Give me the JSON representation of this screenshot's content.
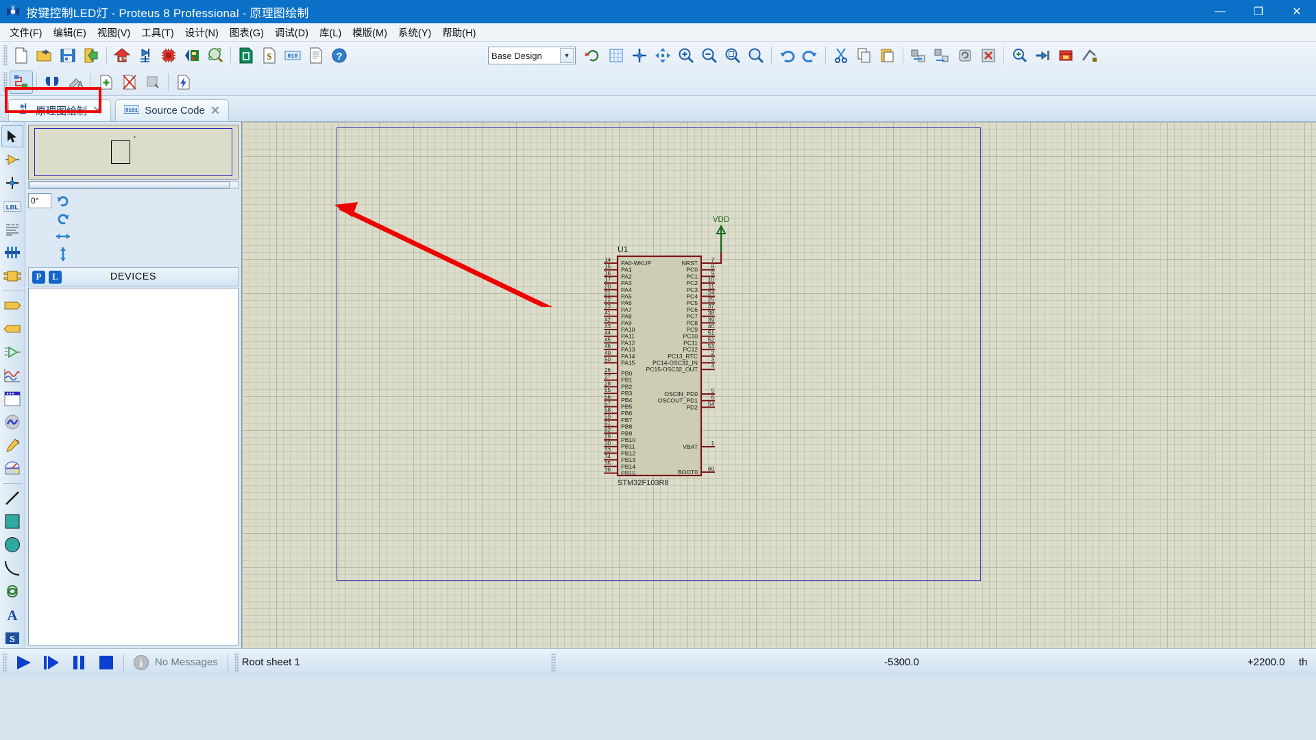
{
  "window": {
    "title": "按键控制LED灯 - Proteus 8 Professional - 原理图绘制",
    "app_icon": "proteus-icon",
    "minimize": "—",
    "maximize": "❐",
    "close": "✕"
  },
  "menubar": {
    "items": [
      {
        "label": "文件(F)",
        "name": "menu-file"
      },
      {
        "label": "编辑(E)",
        "name": "menu-edit"
      },
      {
        "label": "视图(V)",
        "name": "menu-view"
      },
      {
        "label": "工具(T)",
        "name": "menu-tools"
      },
      {
        "label": "设计(N)",
        "name": "menu-design"
      },
      {
        "label": "图表(G)",
        "name": "menu-graph"
      },
      {
        "label": "调试(D)",
        "name": "menu-debug"
      },
      {
        "label": "库(L)",
        "name": "menu-library"
      },
      {
        "label": "模版(M)",
        "name": "menu-template"
      },
      {
        "label": "系统(Y)",
        "name": "menu-system"
      },
      {
        "label": "帮助(H)",
        "name": "menu-help"
      }
    ]
  },
  "toolbar": {
    "design_selector": {
      "value": "Base Design",
      "caret": "▼"
    },
    "row1_icons": [
      "new-project-icon",
      "open-project-icon",
      "save-project-icon",
      "import-export-icon",
      "home-page-icon",
      "schematic-capture-icon",
      "pcb-layout-icon",
      "3d-visualizer-icon",
      "design-explorer-icon",
      "bill-of-materials-icon",
      "billing-icon",
      "source-code-icon",
      "project-notes-icon",
      "help-icon"
    ],
    "row1b_icons": [
      "refresh-icon",
      "grid-toggle-icon",
      "origin-icon",
      "pan-icon",
      "zoom-in-icon",
      "zoom-out-icon",
      "zoom-area-icon",
      "zoom-all-icon",
      "undo-icon",
      "redo-icon",
      "cut-icon",
      "copy-icon",
      "paste-icon",
      "block-copy-icon",
      "block-move-icon",
      "block-rotate-icon",
      "block-delete-icon",
      "pick-device-icon",
      "make-device-icon",
      "packaging-tool-icon",
      "decompose-icon"
    ],
    "row2_icons": [
      "wire-auto-router-icon",
      "search-tag-icon",
      "property-assignment-icon",
      "new-sheet-icon",
      "remove-sheet-icon",
      "exit-sheet-icon",
      "design-explorer2-icon"
    ]
  },
  "tabs": [
    {
      "label": "原理图绘制",
      "icon": "schematic-tab-icon",
      "close": "✕",
      "selected": true,
      "name": "tab-schematic"
    },
    {
      "label": "Source Code",
      "icon": "source-code-tab-icon",
      "close": "✕",
      "selected": false,
      "name": "tab-source-code"
    }
  ],
  "toolbox": {
    "items": [
      {
        "name": "selection-mode-icon",
        "selected": true
      },
      {
        "name": "component-mode-icon",
        "selected": false
      },
      {
        "name": "junction-dot-icon",
        "selected": false
      },
      {
        "name": "wire-label-icon",
        "selected": false,
        "text": "LBL"
      },
      {
        "name": "text-script-icon",
        "selected": false
      },
      {
        "name": "bus-mode-icon",
        "selected": false
      },
      {
        "name": "subcircuit-icon",
        "selected": false
      },
      {
        "name": "terminals-mode-icon",
        "selected": false
      },
      {
        "name": "device-pins-icon",
        "selected": false
      },
      {
        "name": "graph-mode-icon",
        "selected": false
      },
      {
        "name": "tape-recorder-icon",
        "selected": false
      },
      {
        "name": "generator-mode-icon",
        "selected": false
      },
      {
        "name": "voltage-probe-icon",
        "selected": false
      },
      {
        "name": "virtual-instruments-icon",
        "selected": false
      },
      {
        "name": "line-tool-icon",
        "selected": false
      },
      {
        "name": "box-tool-icon",
        "selected": false
      },
      {
        "name": "circle-tool-icon",
        "selected": false
      },
      {
        "name": "arc-tool-icon",
        "selected": false
      },
      {
        "name": "path-tool-icon",
        "selected": false
      },
      {
        "name": "text-tool-icon",
        "selected": false,
        "text": "A"
      },
      {
        "name": "symbol-tool-icon",
        "selected": false,
        "text": "S"
      }
    ]
  },
  "left_panel": {
    "rotation": {
      "angle_value": "0°",
      "rotate_cw_icon": "rotate-clockwise-icon",
      "rotate_ccw_icon": "rotate-counterclockwise-icon",
      "mirror_x_icon": "mirror-horizontal-icon",
      "mirror_y_icon": "mirror-vertical-icon"
    },
    "devices": {
      "p_button": "P",
      "l_button": "L",
      "title": "DEVICES",
      "items": []
    }
  },
  "schematic": {
    "component": {
      "reference": "U1",
      "part_value": "STM32F103R8",
      "left_pins": [
        {
          "num": "14",
          "label": "PA0-WKUP"
        },
        {
          "num": "15",
          "label": "PA1"
        },
        {
          "num": "16",
          "label": "PA2"
        },
        {
          "num": "17",
          "label": "PA3"
        },
        {
          "num": "20",
          "label": "PA4"
        },
        {
          "num": "21",
          "label": "PA5"
        },
        {
          "num": "22",
          "label": "PA6"
        },
        {
          "num": "23",
          "label": "PA7"
        },
        {
          "num": "41",
          "label": "PA8"
        },
        {
          "num": "42",
          "label": "PA9"
        },
        {
          "num": "43",
          "label": "PA10"
        },
        {
          "num": "44",
          "label": "PA11"
        },
        {
          "num": "45",
          "label": "PA12"
        },
        {
          "num": "46",
          "label": "PA13"
        },
        {
          "num": "49",
          "label": "PA14"
        },
        {
          "num": "50",
          "label": "PA15"
        }
      ],
      "left_pins_b": [
        {
          "num": "26",
          "label": "PB0"
        },
        {
          "num": "27",
          "label": "PB1"
        },
        {
          "num": "28",
          "label": "PB2"
        },
        {
          "num": "55",
          "label": "PB3"
        },
        {
          "num": "56",
          "label": "PB4"
        },
        {
          "num": "57",
          "label": "PB5"
        },
        {
          "num": "58",
          "label": "PB6"
        },
        {
          "num": "59",
          "label": "PB7"
        },
        {
          "num": "61",
          "label": "PB8"
        },
        {
          "num": "62",
          "label": "PB9"
        },
        {
          "num": "29",
          "label": "PB10"
        },
        {
          "num": "30",
          "label": "PB11"
        },
        {
          "num": "33",
          "label": "PB12"
        },
        {
          "num": "34",
          "label": "PB13"
        },
        {
          "num": "35",
          "label": "PB14"
        },
        {
          "num": "36",
          "label": "PB15"
        }
      ],
      "right_pins": [
        {
          "num": "7",
          "label": "NRST"
        },
        {
          "num": "8",
          "label": "PC0"
        },
        {
          "num": "9",
          "label": "PC1"
        },
        {
          "num": "10",
          "label": "PC2"
        },
        {
          "num": "11",
          "label": "PC3"
        },
        {
          "num": "24",
          "label": "PC4"
        },
        {
          "num": "25",
          "label": "PC5"
        },
        {
          "num": "37",
          "label": "PC6"
        },
        {
          "num": "38",
          "label": "PC7"
        },
        {
          "num": "39",
          "label": "PC8"
        },
        {
          "num": "40",
          "label": "PC9"
        },
        {
          "num": "51",
          "label": "PC10"
        },
        {
          "num": "52",
          "label": "PC11"
        },
        {
          "num": "53",
          "label": "PC12"
        },
        {
          "num": "2",
          "label": "PC13_RTC"
        },
        {
          "num": "3",
          "label": "PC14-OSC32_IN"
        },
        {
          "num": "4",
          "label": "PC15-OSC32_OUT"
        }
      ],
      "right_pins_d": [
        {
          "num": "5",
          "label": "OSCIN_PD0"
        },
        {
          "num": "6",
          "label": "OSCOUT_PD1"
        },
        {
          "num": "54",
          "label": "PD2"
        }
      ],
      "right_pins_misc": [
        {
          "num": "1",
          "label": "VBAT"
        },
        {
          "num": "60",
          "label": "BOOT0"
        }
      ]
    },
    "power": {
      "label": "VDD",
      "symbol": "power-terminal-icon"
    },
    "colors": {
      "body_fill": "#cdcdb4",
      "body_outline": "#7a1414",
      "pin_color": "#7a1414",
      "text_color": "#1a1a1a",
      "power_color": "#1a6b1a",
      "grid_major": "#b6b6a2",
      "grid_minor": "#c6c6b4",
      "canvas_bg": "#dcdccb",
      "sheet_border": "#3a3aa8"
    }
  },
  "annotation": {
    "box_color": "#ef0000",
    "arrow_color": "#ef0000",
    "target": "tab-schematic"
  },
  "statusbar": {
    "play_icon": "play-icon",
    "step_icon": "step-icon",
    "pause_icon": "pause-icon",
    "stop_icon": "stop-icon",
    "message_icon": "info-icon",
    "message": "No Messages",
    "sheet": "Root sheet 1",
    "coord_x": "-5300.0",
    "coord_y": "+2200.0",
    "units": "th"
  }
}
